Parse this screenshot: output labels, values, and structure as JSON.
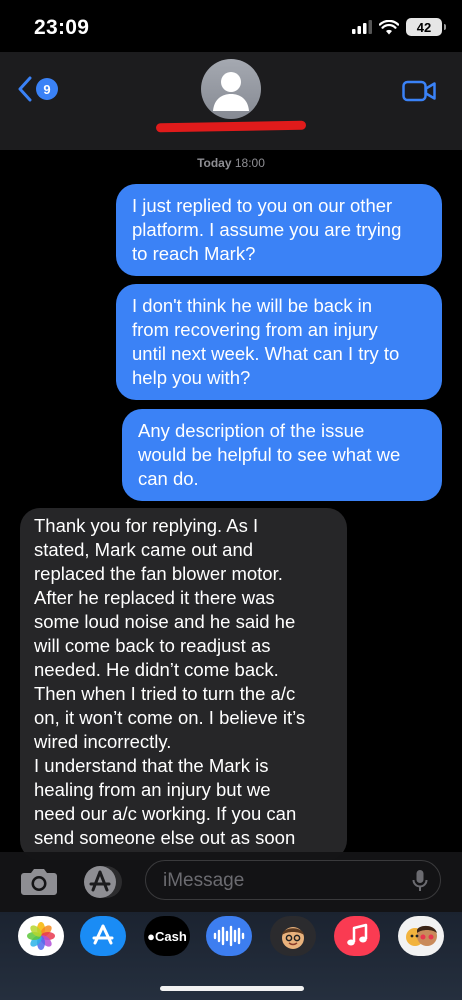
{
  "status_bar": {
    "time": "23:09",
    "battery": "42"
  },
  "header": {
    "unread_count": "9"
  },
  "thread": {
    "date_day": "Today",
    "date_time": "18:00",
    "sent_messages": [
      {
        "lines": [
          "I just replied to you on our other",
          "platform. I assume you are trying",
          "to reach Mark?"
        ]
      },
      {
        "lines": [
          "I don't think he will be back in",
          "from recovering from an injury",
          "until next week. What can I try to",
          "help you with?"
        ]
      },
      {
        "lines": [
          "Any description of the issue",
          "would be helpful to see what we",
          "can do."
        ]
      }
    ],
    "received_message": {
      "lines": [
        "Thank you for replying. As I",
        "stated, Mark came out and",
        "replaced the fan blower motor.",
        "After he replaced it there was",
        "some loud noise and he said he",
        "will come back to readjust as",
        "needed. He didn’t come  back.",
        "Then when I tried to turn the a/c",
        "on, it won’t come on. I believe it’s",
        "wired incorrectly.",
        "I understand that the Mark is",
        "healing from an injury but we",
        "need our a/c working. If you can",
        "send someone else out as soon"
      ]
    }
  },
  "input": {
    "placeholder": "iMessage"
  },
  "app_drawer": {
    "cash_label": "Cash",
    "icons": [
      "photos-icon",
      "app-store-icon",
      "apple-cash-icon",
      "audio-message-icon",
      "memoji-icon",
      "music-icon",
      "memoji-stickers-icon"
    ]
  },
  "colors": {
    "sent_bubble": "#3b82f6",
    "received_bubble": "#262628",
    "accent": "#3a82f7",
    "redaction": "#e01b1b"
  }
}
